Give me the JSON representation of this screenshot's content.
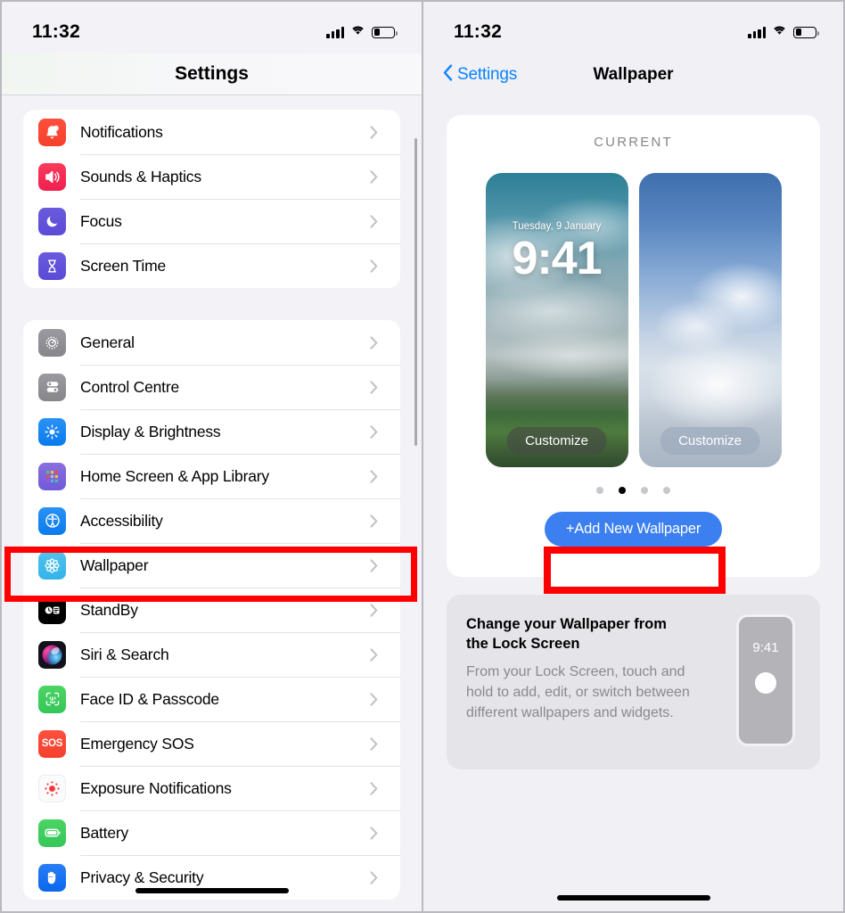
{
  "left_panel": {
    "status": {
      "time": "11:32",
      "signal_icon": "cellular-bars-icon",
      "wifi_icon": "wifi-icon",
      "battery_icon": "battery-icon"
    },
    "navbar": {
      "title": "Settings"
    },
    "groups": [
      {
        "items": [
          {
            "label": "Notifications",
            "icon": "notifications-icon"
          },
          {
            "label": "Sounds & Haptics",
            "icon": "sounds-haptics-icon"
          },
          {
            "label": "Focus",
            "icon": "focus-icon"
          },
          {
            "label": "Screen Time",
            "icon": "screen-time-icon"
          }
        ]
      },
      {
        "items": [
          {
            "label": "General",
            "icon": "general-icon"
          },
          {
            "label": "Control Centre",
            "icon": "control-centre-icon"
          },
          {
            "label": "Display & Brightness",
            "icon": "display-brightness-icon"
          },
          {
            "label": "Home Screen & App Library",
            "icon": "home-screen-icon"
          },
          {
            "label": "Accessibility",
            "icon": "accessibility-icon"
          },
          {
            "label": "Wallpaper",
            "icon": "wallpaper-icon"
          },
          {
            "label": "StandBy",
            "icon": "standby-icon"
          },
          {
            "label": "Siri & Search",
            "icon": "siri-search-icon"
          },
          {
            "label": "Face ID & Passcode",
            "icon": "face-id-icon"
          },
          {
            "label": "Emergency SOS",
            "icon": "emergency-sos-icon"
          },
          {
            "label": "Exposure Notifications",
            "icon": "exposure-notifications-icon"
          },
          {
            "label": "Battery",
            "icon": "battery-settings-icon"
          },
          {
            "label": "Privacy & Security",
            "icon": "privacy-security-icon"
          }
        ]
      }
    ]
  },
  "right_panel": {
    "status": {
      "time": "11:32"
    },
    "navbar": {
      "back_label": "Settings",
      "title": "Wallpaper"
    },
    "wallpaper_card": {
      "section_label": "CURRENT",
      "lock_screen": {
        "date": "Tuesday, 9 January",
        "time": "9:41",
        "customize_label": "Customize"
      },
      "home_screen": {
        "customize_label": "Customize"
      },
      "page_dots": {
        "count": 4,
        "active_index": 1
      },
      "add_button_label": "+Add New Wallpaper"
    },
    "info_card": {
      "title": "Change your Wallpaper from the Lock Screen",
      "body": "From your Lock Screen, touch and hold to add, edit, or switch between different wallpapers and widgets.",
      "mini_phone_time": "9:41"
    }
  },
  "annotations": {
    "highlight_color": "#ff0000",
    "highlighted_items": [
      "Wallpaper",
      "+Add New Wallpaper"
    ]
  },
  "colors": {
    "accent_blue": "#0a84ff",
    "button_blue": "#3b7ff0",
    "panel_bg": "#f2f2f7",
    "card_bg": "#ffffff",
    "info_card_bg": "#e4e4e9"
  }
}
